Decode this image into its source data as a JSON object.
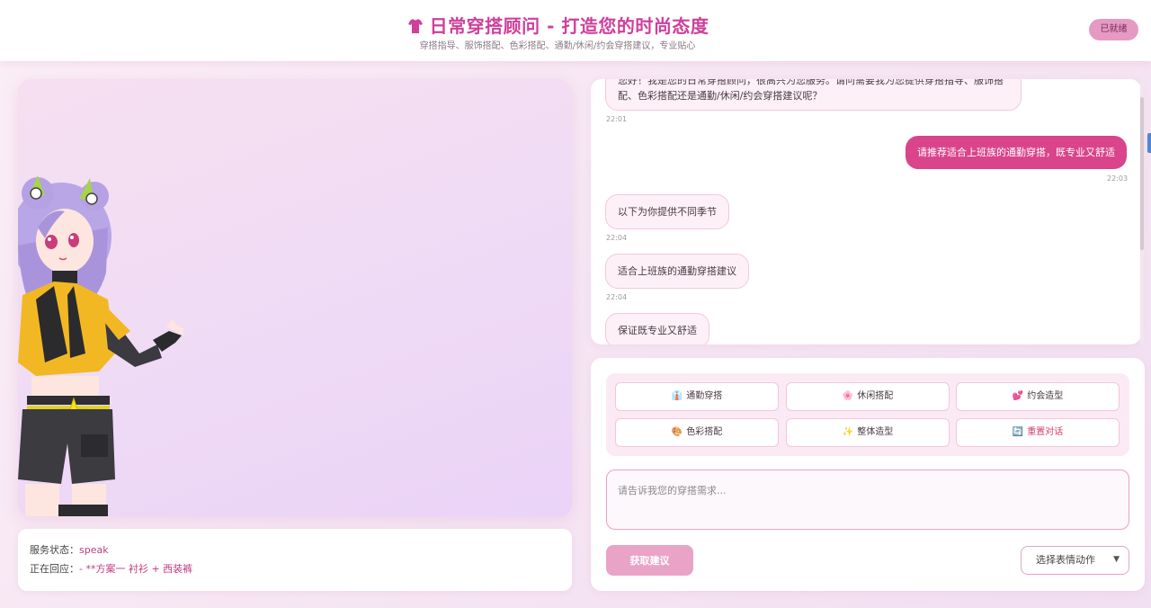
{
  "header": {
    "title": "日常穿搭顾问 - 打造您的时尚态度",
    "subtitle": "穿搭指导、服饰搭配、色彩搭配、通勤/休闲/约会穿搭建议，专业贴心",
    "status": "已就绪"
  },
  "info": {
    "service_label": "服务状态：",
    "service_value": "speak",
    "reply_label": "正在回应：",
    "reply_value": "- **方案一 衬衫 + 西装裤"
  },
  "chat": {
    "messages": [
      {
        "role": "bot",
        "text_line1": "您好！我是您的日常穿搭顾问，很高兴为您服务。请问需要我为您提供穿搭指导、服饰搭",
        "text_line2": "配、色彩搭配还是通勤/休闲/约会穿搭建议呢？",
        "time": "22:01"
      },
      {
        "role": "user",
        "text": "请推荐适合上班族的通勤穿搭，既专业又舒适",
        "time": "22:03"
      },
      {
        "role": "bot",
        "text": "以下为你提供不同季节",
        "time": "22:04"
      },
      {
        "role": "bot",
        "text": "适合上班族的通勤穿搭建议",
        "time": "22:04"
      },
      {
        "role": "bot",
        "text": "保证既专业又舒适",
        "time": ""
      }
    ]
  },
  "quick_buttons": [
    {
      "icon": "👔",
      "label": "通勤穿搭"
    },
    {
      "icon": "🌸",
      "label": "休闲搭配"
    },
    {
      "icon": "💕",
      "label": "约会造型"
    },
    {
      "icon": "🎨",
      "label": "色彩搭配"
    },
    {
      "icon": "✨",
      "label": "整体造型"
    },
    {
      "icon": "🔄",
      "label": "重置对话"
    }
  ],
  "input": {
    "placeholder": "请告诉我您的穿搭需求...",
    "value": ""
  },
  "submit_label": "获取建议",
  "expression_select": {
    "selected": "选择表情动作"
  },
  "colors": {
    "accent": "#cf3f9b",
    "user_bubble": "#d9448a",
    "button_pink": "#e9a3c7"
  }
}
